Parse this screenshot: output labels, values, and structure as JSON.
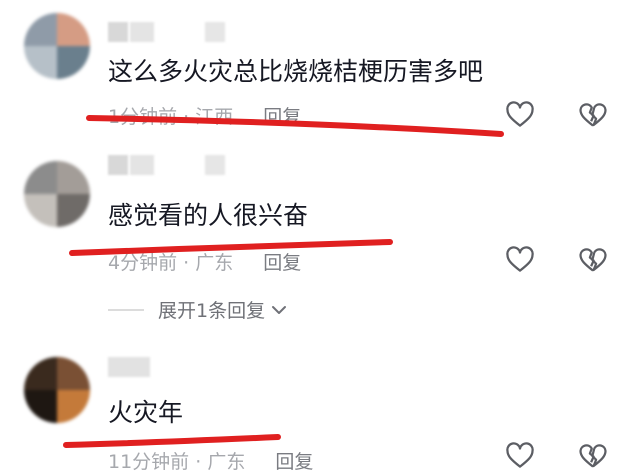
{
  "comments": [
    {
      "text": "这么多火灾总比烧烧桔梗历害多吧",
      "time": "1分钟前",
      "region": "江西",
      "reply": "回复",
      "avatar_colors": [
        "#8f9ba8",
        "#d59c84",
        "#6a7f8d",
        "#b6c0c8"
      ]
    },
    {
      "text": "感觉看的人很兴奋",
      "time": "4分钟前",
      "region": "广东",
      "reply": "回复",
      "avatar_colors": [
        "#8c8c8c",
        "#a39d98",
        "#6f6b68",
        "#c4c0bb"
      ]
    },
    {
      "text": "火灾年",
      "time": "11分钟前",
      "region": "广东",
      "reply": "回复",
      "avatar_colors": [
        "#3a2a1e",
        "#7a5034",
        "#c47a3a",
        "#1e1712"
      ]
    }
  ],
  "expand_replies": "展开1条回复",
  "colors": {
    "underline": "#e02020",
    "meta": "#a6a8ad",
    "icon_stroke": "#5c5e64"
  },
  "icons": {
    "like": "heart-outline-icon",
    "dislike": "broken-heart-icon",
    "expand": "chevron-down-icon"
  }
}
